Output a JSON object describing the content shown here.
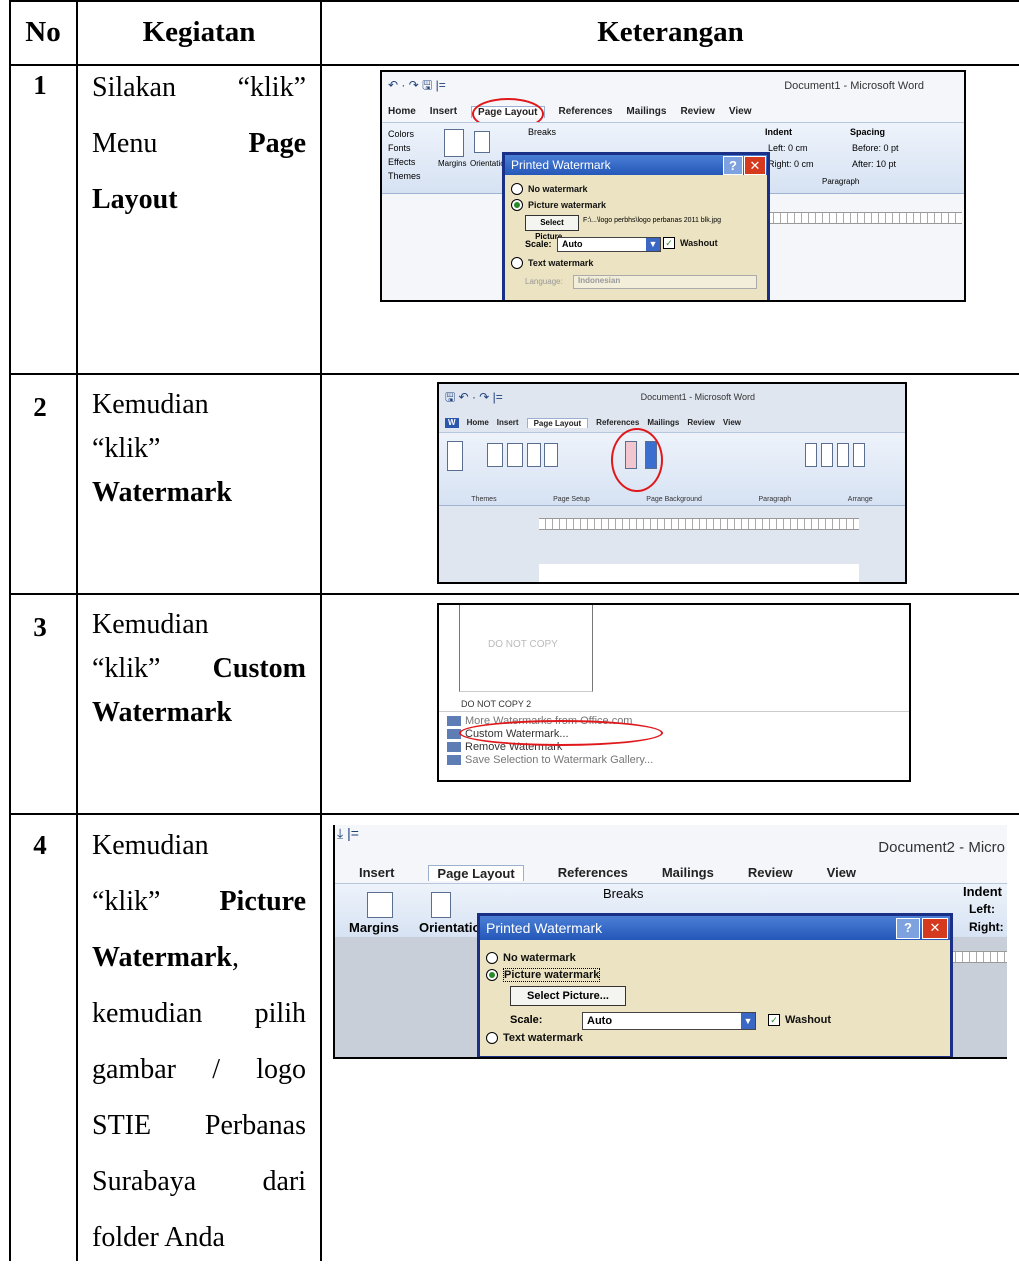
{
  "table": {
    "headers": [
      "No",
      "Kegiatan",
      "Keterangan"
    ],
    "rows": [
      {
        "no": "1",
        "k1": "Silakan",
        "k2": "“klik”",
        "k3": "Menu",
        "k4": "Page",
        "k5": "Layout"
      },
      {
        "no": "2",
        "k1": "Kemudian",
        "k2": "“klik”",
        "k3": "Watermark"
      },
      {
        "no": "3",
        "k1": "Kemudian",
        "k2": "“klik”",
        "k3": "Custom",
        "k4": "Watermark"
      },
      {
        "no": "4",
        "k1": "Kemudian",
        "k2": "“klik”",
        "k3": "Picture",
        "k4": "Watermark",
        "k4b": ",",
        "k5": "kemudian",
        "k5b": "pilih",
        "k6": "gambar",
        "k6b": "/",
        "k6c": "logo",
        "k7": "STIE",
        "k7b": "Perbanas",
        "k8": "Surabaya",
        "k8b": "dari",
        "k9": "folder Anda"
      }
    ]
  },
  "shot1": {
    "title": "Document1 - Microsoft Word",
    "tabs": [
      "Home",
      "Insert",
      "Page Layout",
      "References",
      "Mailings",
      "Review",
      "View"
    ],
    "dialog_title": "Printed Watermark",
    "opt_none": "No watermark",
    "opt_picture": "Picture watermark",
    "select_btn": "Select Picture...",
    "file_path": "F:\\...\\logo perbhs\\logo perbanas 2011 blk.jpg",
    "scale_label": "Scale:",
    "scale_value": "Auto",
    "washout": "Washout",
    "opt_text": "Text watermark",
    "language_label": "Language:",
    "language_value": "Indonesian",
    "indent": "Indent",
    "spacing": "Spacing",
    "left": "Left:",
    "left_val": "0 cm",
    "right": "Right:",
    "right_val": "0 cm",
    "before": "Before:",
    "before_val": "0 pt",
    "after": "After:",
    "after_val": "10 pt",
    "paragraph": "Paragraph",
    "themes": "Themes",
    "colors": "Colors",
    "fonts": "Fonts",
    "effects": "Effects",
    "margins": "Margins",
    "orientation": "Orientation",
    "breaks": "Breaks"
  },
  "shot2": {
    "title": "Document1 - Microsoft Word",
    "tabs": [
      "Home",
      "Insert",
      "Page Layout",
      "References",
      "Mailings",
      "Review",
      "View"
    ],
    "groups": [
      "Themes",
      "Page Setup",
      "Page Background",
      "Paragraph",
      "Arrange"
    ]
  },
  "shot3": {
    "thumb_text": "DO NOT COPY",
    "thumb_caption": "DO NOT COPY 2",
    "items": [
      "More Watermarks from Office.com",
      "Custom Watermark...",
      "Remove Watermark",
      "Save Selection to Watermark Gallery..."
    ]
  },
  "shot4": {
    "title": "Document2 - Micro",
    "tabs": [
      "Insert",
      "Page Layout",
      "References",
      "Mailings",
      "Review",
      "View"
    ],
    "margins": "Margins",
    "orientation": "Orientatio",
    "breaks": "Breaks",
    "indent": "Indent",
    "left": "Left:",
    "right": "Right:",
    "dialog_title": "Printed Watermark",
    "opt_none": "No watermark",
    "opt_picture": "Picture watermark",
    "select_btn": "Select Picture...",
    "scale_label": "Scale:",
    "scale_value": "Auto",
    "washout": "Washout",
    "opt_text": "Text watermark"
  },
  "colors": {
    "dialog_border": "#1a2f86",
    "dialog_bg": "#ebe3c2",
    "highlight_oval": "#e0181b"
  }
}
